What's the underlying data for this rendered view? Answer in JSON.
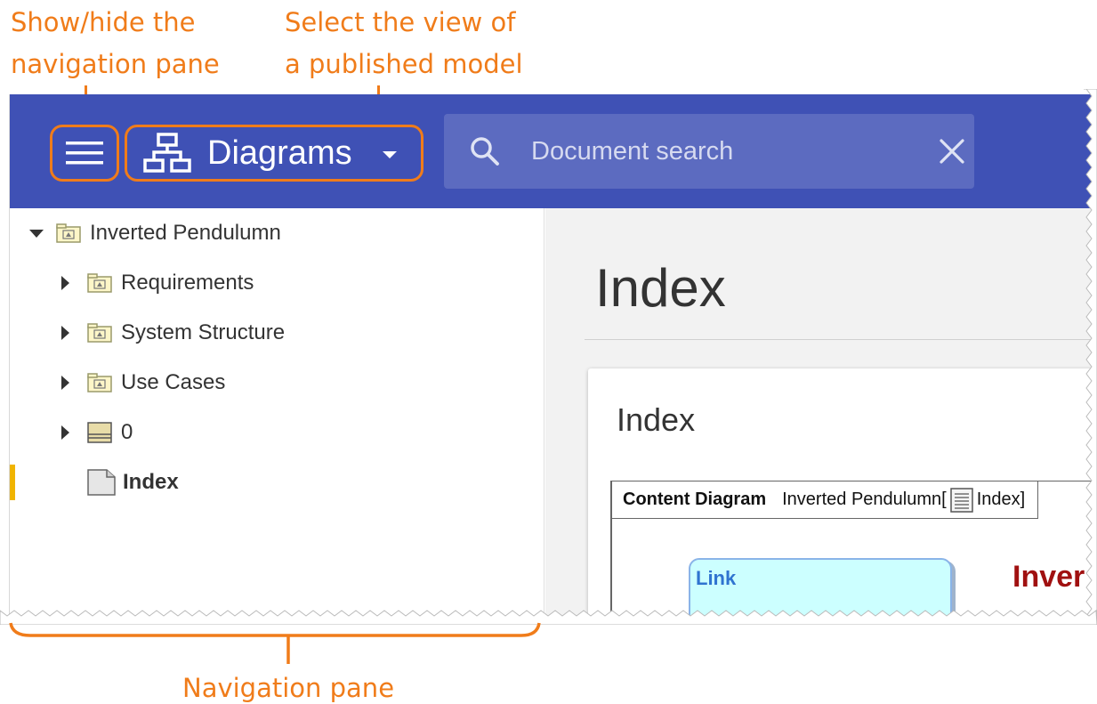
{
  "annotations": {
    "toggle_nav": "Show/hide the\nnavigation pane",
    "select_view": "Select the view of\na published model",
    "nav_pane": "Navigation pane"
  },
  "colors": {
    "header": "#3f51b5",
    "search_bg": "#5c6bc0",
    "annotation": "#f07c1a",
    "selected_marker": "#f0b400"
  },
  "header": {
    "menu_icon": "hamburger-menu-icon",
    "view_selector": {
      "icon": "hierarchy-diagram-icon",
      "label": "Diagrams",
      "dropdown_icon": "caret-down-icon"
    },
    "search": {
      "icon": "search-icon",
      "placeholder": "Document search",
      "value": "",
      "clear_icon": "close-icon"
    }
  },
  "nav_tree": {
    "root": {
      "label": "Inverted Pendulumn",
      "expanded": true,
      "icon": "package-folder-icon"
    },
    "children": [
      {
        "label": "Requirements",
        "icon": "package-folder-icon",
        "expanded": false
      },
      {
        "label": "System Structure",
        "icon": "package-folder-icon",
        "expanded": false
      },
      {
        "label": "Use Cases",
        "icon": "package-folder-icon",
        "expanded": false
      },
      {
        "label": "0",
        "icon": "model-icon",
        "expanded": false
      },
      {
        "label": "Index",
        "icon": "document-icon",
        "selected": true
      }
    ]
  },
  "content": {
    "page_title": "Index",
    "card_title": "Index",
    "diagram": {
      "kind": "Content Diagram",
      "name": "Inverted Pendulumn[",
      "index_icon": "document-list-icon",
      "index_label": "Index]",
      "link_label": "Link",
      "heading_fragment": "Inver"
    }
  }
}
